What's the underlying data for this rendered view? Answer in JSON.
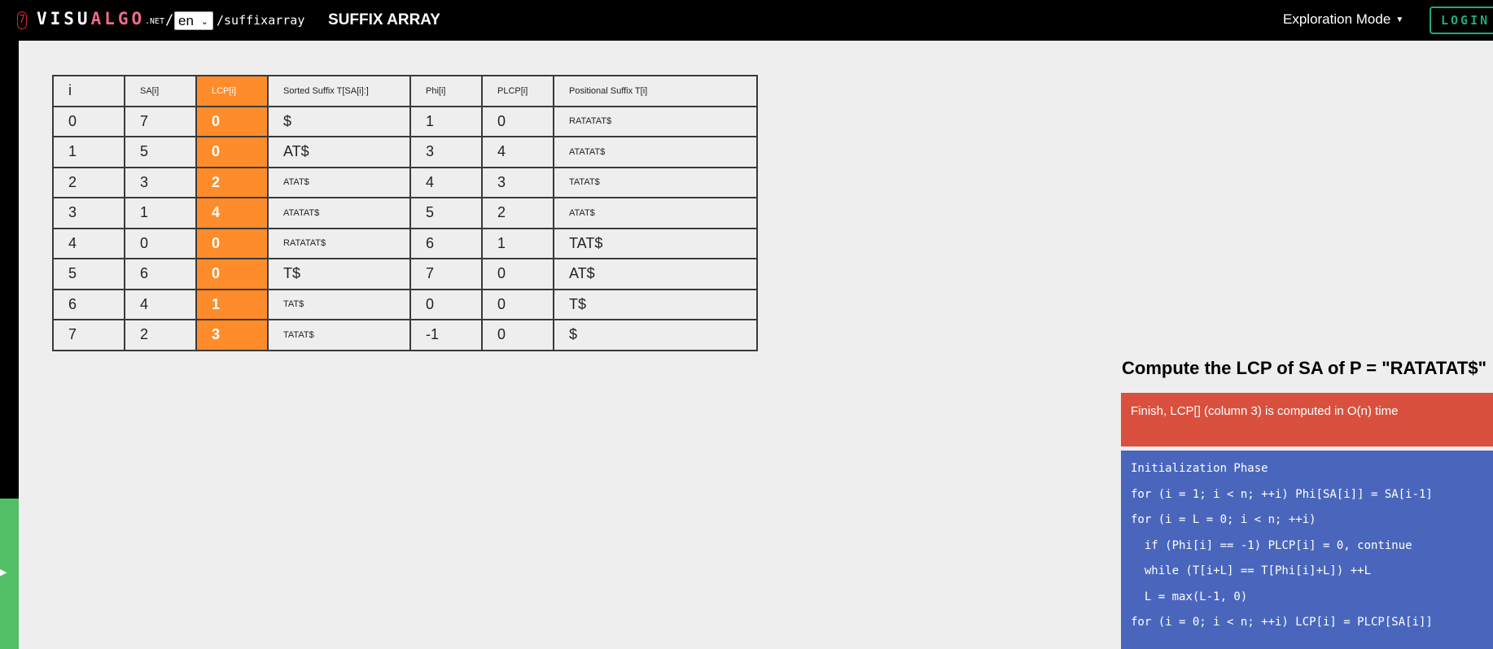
{
  "header": {
    "logo_icon": "7",
    "logo_white": "VISU",
    "logo_pink": "ALGO",
    "logo_net": ".NET",
    "slash": "/",
    "lang": "en",
    "path": "/suffixarray",
    "title": "SUFFIX ARRAY",
    "mode": "Exploration Mode",
    "login": "LOGIN"
  },
  "table": {
    "headers": [
      "i",
      "SA[i]",
      "LCP[i]",
      "Sorted Suffix T[SA[i]:]",
      "Phi[i]",
      "PLCP[i]",
      "Positional Suffix T[i]"
    ],
    "rows": [
      [
        "0",
        "7",
        "0",
        "$",
        "1",
        "0",
        "RATATAT$"
      ],
      [
        "1",
        "5",
        "0",
        "AT$",
        "3",
        "4",
        "ATATAT$"
      ],
      [
        "2",
        "3",
        "2",
        "ATAT$",
        "4",
        "3",
        "TATAT$"
      ],
      [
        "3",
        "1",
        "4",
        "ATATAT$",
        "5",
        "2",
        "ATAT$"
      ],
      [
        "4",
        "0",
        "0",
        "RATATAT$",
        "6",
        "1",
        "TAT$"
      ],
      [
        "5",
        "6",
        "0",
        "T$",
        "7",
        "0",
        "AT$"
      ],
      [
        "6",
        "4",
        "1",
        "TAT$",
        "0",
        "0",
        "T$"
      ],
      [
        "7",
        "2",
        "3",
        "TATAT$",
        "-1",
        "0",
        "$"
      ]
    ]
  },
  "status": {
    "title": "Compute the LCP of SA of P = \"RATATAT$\"",
    "message": "Finish, LCP[] (column 3) is computed in O(n) time"
  },
  "code": [
    "Initialization Phase",
    "for (i = 1; i < n; ++i) Phi[SA[i]] = SA[i-1]",
    "for (i = L = 0; i < n; ++i)",
    "  if (Phi[i] == -1) PLCP[i] = 0, continue",
    "  while (T[i+L] == T[Phi[i]+L]) ++L",
    "  L = max(L-1, 0)",
    "for (i = 0; i < n; ++i) LCP[i] = PLCP[SA[i]]"
  ],
  "colors": {
    "lcp_column": "#ff8c2a",
    "status_red": "#d9513e",
    "code_blue": "#4a66bc",
    "side_green": "#52bf67"
  }
}
